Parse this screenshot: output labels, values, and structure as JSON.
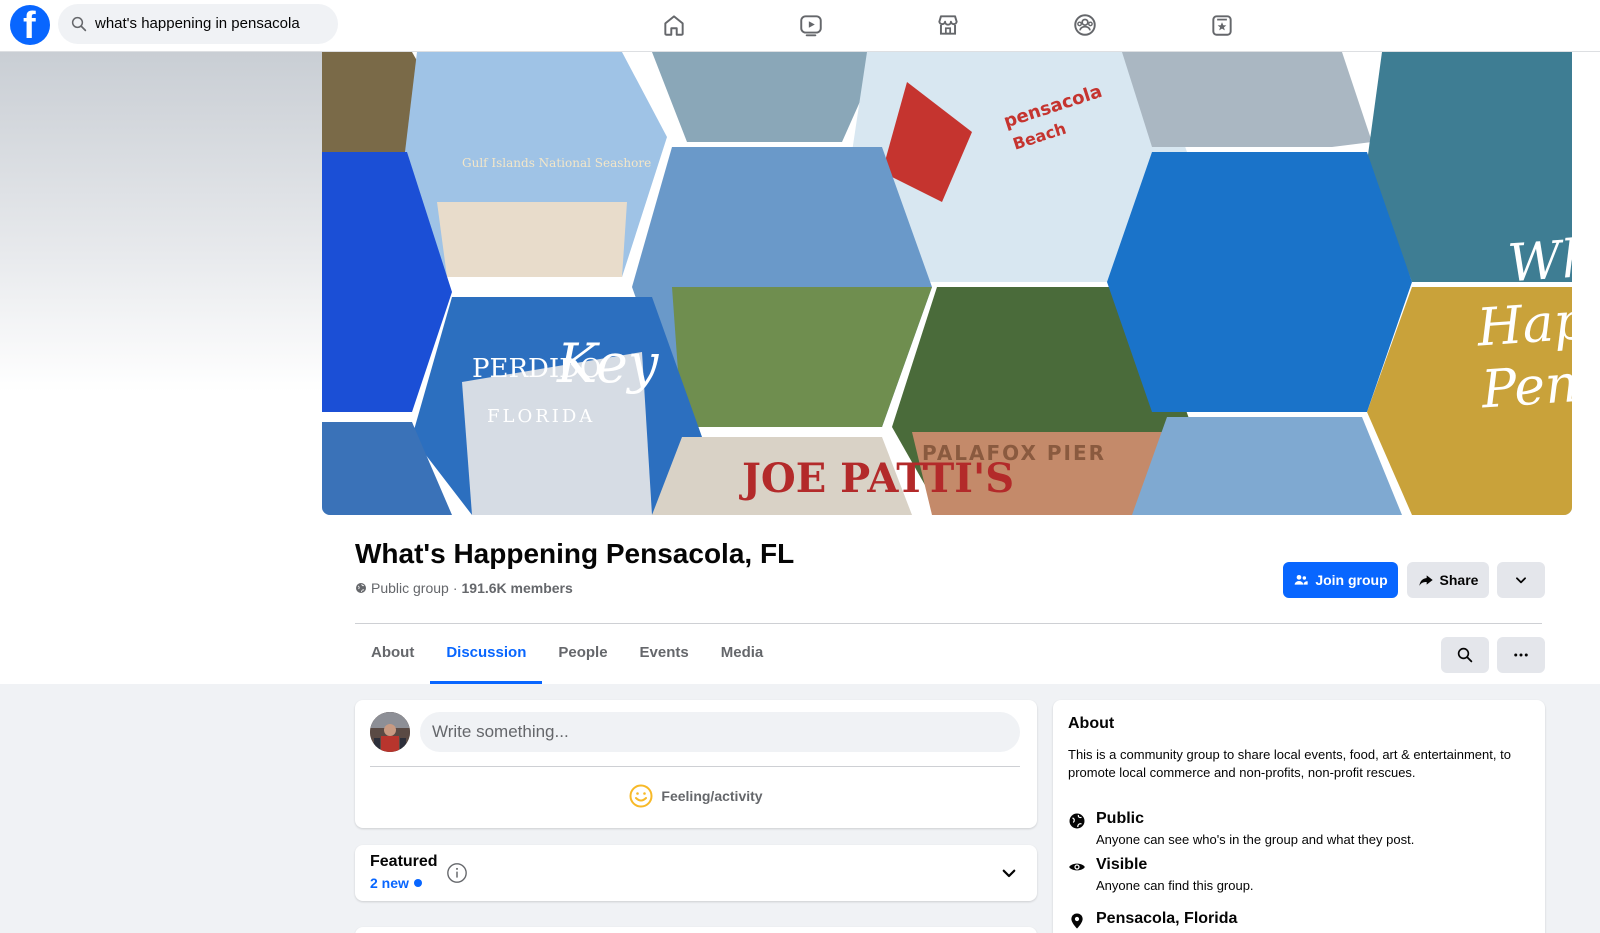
{
  "search": {
    "query": "what's happening in pensacola"
  },
  "nav": {
    "icons": [
      "home-icon",
      "video-icon",
      "marketplace-icon",
      "groups-icon",
      "gaming-icon"
    ]
  },
  "cover": {
    "title_lines": [
      "What's",
      "Happening",
      "Pensacola"
    ]
  },
  "group": {
    "name": "What's Happening Pensacola, FL",
    "privacy": "Public group",
    "separator": "·",
    "members": "191.6K members",
    "join_label": "Join group",
    "share_label": "Share"
  },
  "tabs": [
    {
      "label": "About",
      "active": false
    },
    {
      "label": "Discussion",
      "active": true
    },
    {
      "label": "People",
      "active": false
    },
    {
      "label": "Events",
      "active": false
    },
    {
      "label": "Media",
      "active": false
    }
  ],
  "composer": {
    "placeholder": "Write something...",
    "feeling_label": "Feeling/activity"
  },
  "featured": {
    "title": "Featured",
    "new_count": "2 new"
  },
  "about": {
    "title": "About",
    "description": "This is a community group to share local events, food, art & entertainment, to promote local commerce and non-profits, non-profit rescues.",
    "public_title": "Public",
    "public_desc": "Anyone can see who's in the group and what they post.",
    "visible_title": "Visible",
    "visible_desc": "Anyone can find this group.",
    "location": "Pensacola, Florida"
  },
  "colors": {
    "brand": "#0866ff",
    "background": "#f0f2f5",
    "secondary_text": "#65676b"
  }
}
